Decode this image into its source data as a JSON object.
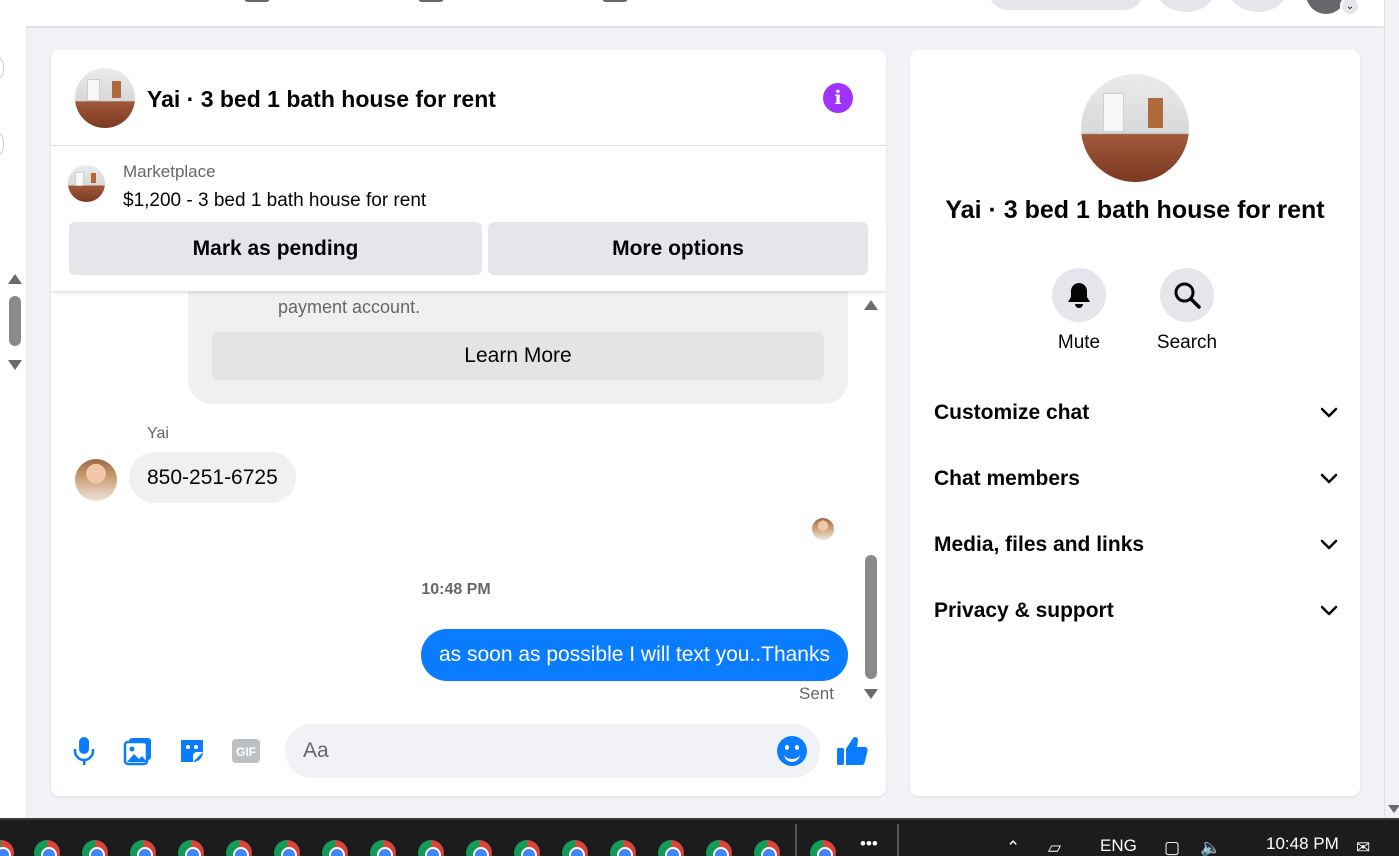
{
  "chat": {
    "title": "Yai · 3 bed 1 bath house for rent",
    "listing": {
      "kicker": "Marketplace",
      "subtitle": "$1,200 - 3 bed 1 bath house for rent",
      "mark_pending_label": "Mark as pending",
      "more_options_label": "More options"
    },
    "card": {
      "text": "payment account.",
      "learn_more_label": "Learn More"
    },
    "messages": [
      {
        "sender": "Yai",
        "text": "850-251-6725"
      }
    ],
    "timestamp": "10:48 PM",
    "outgoing": {
      "text": "as soon as possible I will text you..Thanks",
      "status": "Sent"
    },
    "composer": {
      "placeholder": "Aa"
    }
  },
  "side": {
    "title": "Yai · 3 bed 1 bath house for rent",
    "actions": [
      {
        "label": "Mute",
        "icon": "bell-icon"
      },
      {
        "label": "Search",
        "icon": "search-icon"
      }
    ],
    "sections": [
      {
        "label": "Customize chat"
      },
      {
        "label": "Chat members"
      },
      {
        "label": "Media, files and links"
      },
      {
        "label": "Privacy & support"
      }
    ]
  },
  "taskbar": {
    "language": "ENG",
    "clock": "10:48 PM"
  },
  "colors": {
    "accent": "#0a7cff",
    "info": "#a033ff",
    "surface": "#f0f2f5"
  }
}
